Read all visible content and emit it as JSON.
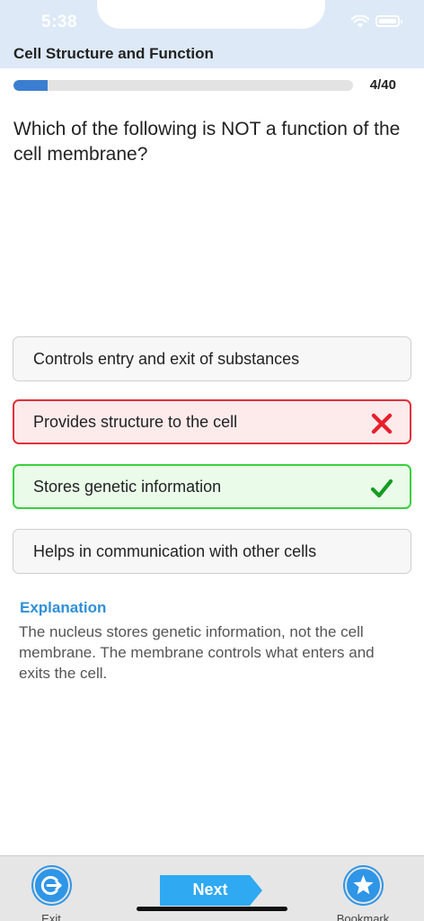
{
  "status_bar": {
    "time": "5:38",
    "icons": [
      "wifi-icon",
      "battery-icon"
    ]
  },
  "header": {
    "topic": "Cell Structure and Function"
  },
  "progress": {
    "current": 4,
    "total": 40,
    "label": "4/40",
    "fraction": 0.1
  },
  "question": {
    "text": "Which of the following is NOT a function of the cell membrane?"
  },
  "options": [
    {
      "label": "Controls entry and exit of substances",
      "state": "neutral"
    },
    {
      "label": "Provides structure to the cell",
      "state": "wrong",
      "icon": "cross-icon"
    },
    {
      "label": "Stores genetic information",
      "state": "correct",
      "icon": "check-icon"
    },
    {
      "label": "Helps in communication with other cells",
      "state": "neutral"
    }
  ],
  "explanation": {
    "heading": "Explanation",
    "body": "The nucleus stores genetic information, not the cell membrane. The membrane controls what enters and exits the cell."
  },
  "bottom_nav": {
    "exit_label": "Exit",
    "next_label": "Next",
    "bookmark_label": "Bookmark"
  },
  "colors": {
    "accent": "#3b7dd0",
    "nav_icon": "#2f95e6",
    "wrong_border": "#e3303c",
    "wrong_bg": "#fdebec",
    "correct_border": "#38d13c",
    "correct_bg": "#eafbea",
    "explanation_heading": "#2f8fd8",
    "next_button": "#2ea9f2"
  }
}
